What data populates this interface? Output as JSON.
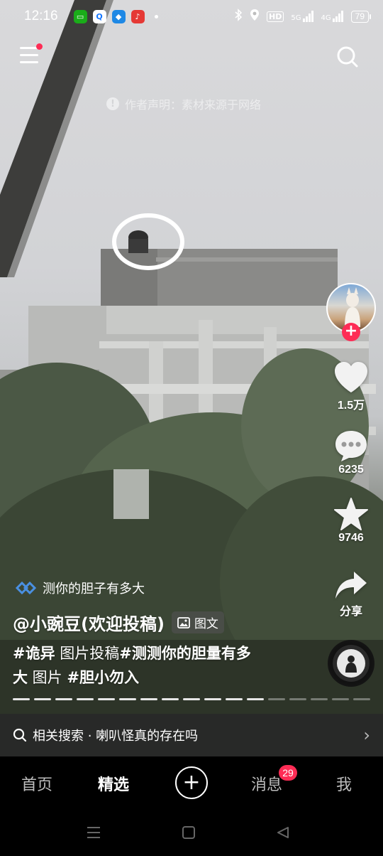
{
  "status_bar": {
    "time": "12:16",
    "network": "5G",
    "hd_label": "HD",
    "data_label": "4G",
    "battery": "79",
    "notification_icons": [
      "messages-app-icon",
      "search-app-icon",
      "store-app-icon",
      "music-app-icon"
    ]
  },
  "top": {
    "author_note": "作者声明：素材来源于网络"
  },
  "rail": {
    "likes": "1.5万",
    "comments": "6235",
    "favorites": "9746",
    "share": "分享"
  },
  "caption": {
    "topic": "测你的胆子有多大",
    "author": "@小豌豆(欢迎投稿)",
    "post_type": "图文",
    "line1_tag1": "#诡异",
    "line1_text1": " 图片投稿",
    "line1_tag2": "#测测你的胆量有多",
    "line2_tag2_cont": "大",
    "line2_text": " 图片 ",
    "line2_tag3": "#胆小勿入",
    "progress": {
      "total": 17,
      "viewed": 12
    }
  },
  "related": {
    "label": "相关搜索 · 喇叭怪真的存在吗"
  },
  "tabs": {
    "home": "首页",
    "featured": "精选",
    "create": "+",
    "messages": "消息",
    "messages_badge": "29",
    "me": "我"
  },
  "colors": {
    "accent": "#fe2c55",
    "background": "#000000"
  }
}
